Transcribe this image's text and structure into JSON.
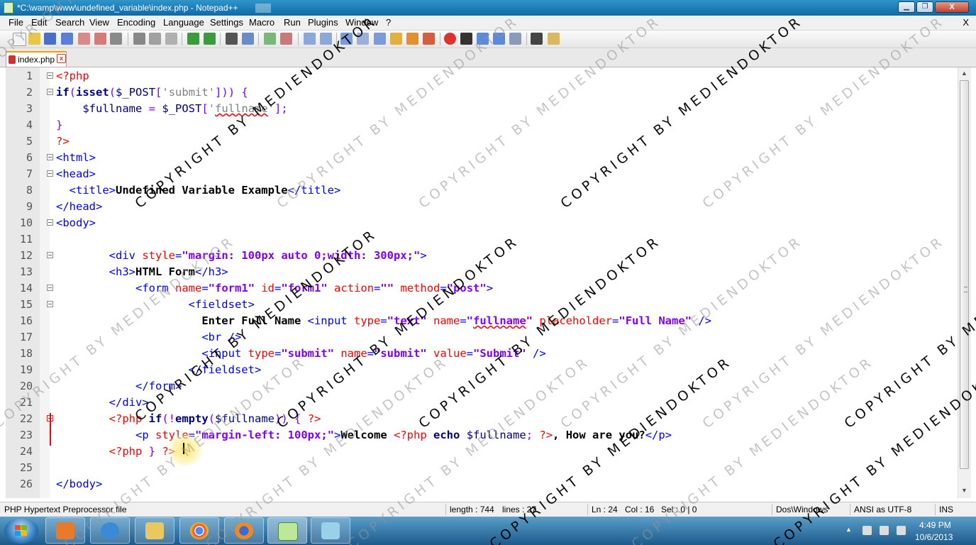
{
  "window": {
    "title": "*C:\\wamp\\www\\undefined_variable\\index.php - Notepad++",
    "minimize": "▁",
    "maximize": "❐",
    "close": "X"
  },
  "menu": [
    "File",
    "Edit",
    "Search",
    "View",
    "Encoding",
    "Language",
    "Settings",
    "Macro",
    "Run",
    "Plugins",
    "Window",
    "?"
  ],
  "menu_close": "X",
  "tab": {
    "label": "index.php",
    "close": "x"
  },
  "editor": {
    "lines": [
      {
        "n": "1",
        "html": "<span class='tk-php'>&lt;?php</span>"
      },
      {
        "n": "2",
        "html": "<span class='tk-kw'>if</span><span class='tk-op'>(</span><span class='tk-kw'>isset</span><span class='tk-op'>(</span><span class='tk-var'>$_POST</span><span class='tk-op'>[</span><span class='tk-str'>'submit'</span><span class='tk-op'>])) {</span>"
      },
      {
        "n": "3",
        "html": "    <span class='tk-var'>$fullname</span> <span class='tk-op'>=</span> <span class='tk-var'>$_POST</span><span class='tk-op'>[</span><span class='tk-str'>'<span class=\"squig\">fullname</span>'</span><span class='tk-op'>];</span>"
      },
      {
        "n": "4",
        "html": "<span class='tk-op'>}</span>"
      },
      {
        "n": "5",
        "html": "<span class='tk-php'>?&gt;</span>"
      },
      {
        "n": "6",
        "html": "<span class='tk-tag'>&lt;html&gt;</span>"
      },
      {
        "n": "7",
        "html": "<span class='tk-tag'>&lt;head&gt;</span>"
      },
      {
        "n": "8",
        "html": "  <span class='tk-tag'>&lt;title&gt;</span><span class='tk-txt'>Undefined Variable Example</span><span class='tk-tag'>&lt;/title&gt;</span>"
      },
      {
        "n": "9",
        "html": "<span class='tk-tag'>&lt;/head&gt;</span>"
      },
      {
        "n": "10",
        "html": "<span class='tk-tag'>&lt;body&gt;</span>"
      },
      {
        "n": "11",
        "html": ""
      },
      {
        "n": "12",
        "html": "        <span class='tk-tag'>&lt;div</span> <span class='tk-attr'>style</span><span class='tk-tag'>=</span><span class='tk-val'>\"margin: 100px auto 0;width: 300px;\"</span><span class='tk-tag'>&gt;</span>"
      },
      {
        "n": "13",
        "html": "        <span class='tk-tag'>&lt;h3&gt;</span><span class='tk-txt'>HTML Form</span><span class='tk-tag'>&lt;/h3&gt;</span>"
      },
      {
        "n": "14",
        "html": "            <span class='tk-tag'>&lt;form</span> <span class='tk-attr'>name</span><span class='tk-tag'>=</span><span class='tk-val'>\"form1\"</span> <span class='tk-attr'>id</span><span class='tk-tag'>=</span><span class='tk-val'>\"form1\"</span> <span class='tk-attr'>action</span><span class='tk-tag'>=</span><span class='tk-val'>\"\"</span> <span class='tk-attr'>method</span><span class='tk-tag'>=</span><span class='tk-val'>\"post\"</span><span class='tk-tag'>&gt;</span>"
      },
      {
        "n": "15",
        "html": "                    <span class='tk-tag'>&lt;fieldset&gt;</span>"
      },
      {
        "n": "16",
        "html": "                      <span class='tk-txt'>Enter Full Name</span> <span class='tk-tag'>&lt;input</span> <span class='tk-attr'>type</span><span class='tk-tag'>=</span><span class='tk-val'>\"text\"</span> <span class='tk-attr'>name</span><span class='tk-tag'>=</span><span class='tk-val'>\"<span class=\"squig\">fullname</span>\"</span> <span class='tk-attr'>placeholder</span><span class='tk-tag'>=</span><span class='tk-val'>\"Full Name\"</span> <span class='tk-tag'>/&gt;</span>"
      },
      {
        "n": "17",
        "html": "                      <span class='tk-tag'>&lt;br /&gt;</span>"
      },
      {
        "n": "18",
        "html": "                      <span class='tk-tag'>&lt;input</span> <span class='tk-attr'>type</span><span class='tk-tag'>=</span><span class='tk-val'>\"submit\"</span> <span class='tk-attr'>name</span><span class='tk-tag'>=</span><span class='tk-val'>\"submit\"</span> <span class='tk-attr'>value</span><span class='tk-tag'>=</span><span class='tk-val'>\"Submit\"</span> <span class='tk-tag'>/&gt;</span>"
      },
      {
        "n": "19",
        "html": "                    <span class='tk-tag'>&lt;/fieldset&gt;</span>"
      },
      {
        "n": "20",
        "html": "            <span class='tk-tag'>&lt;/form&gt;</span>"
      },
      {
        "n": "21",
        "html": "        <span class='tk-tag'>&lt;/div&gt;</span>"
      },
      {
        "n": "22",
        "html": "        <span class='tk-php'>&lt;?php</span> <span class='tk-kw'>if</span><span class='tk-op'>(!</span><span class='tk-kw'>empty</span><span class='tk-op'>(</span><span class='tk-var'>$fullname</span><span class='tk-op'>)) {</span> <span class='tk-php'>?&gt;</span>"
      },
      {
        "n": "23",
        "html": "            <span class='tk-tag'>&lt;p</span> <span class='tk-attr'>style</span><span class='tk-tag'>=</span><span class='tk-val'>\"margin-left: 100px;\"</span><span class='tk-tag'>&gt;</span><span class='tk-txt'>Welcome</span> <span class='tk-php'>&lt;?php</span> <span class='tk-kw'>echo</span> <span class='tk-var'>$fullname</span><span class='tk-op'>;</span> <span class='tk-php'>?&gt;</span><span class='tk-txt'>, How are you?</span><span class='tk-tag'>&lt;/p&gt;</span>"
      },
      {
        "n": "24",
        "html": "        <span class='tk-php'>&lt;?php</span> <span class='tk-op'>}</span> <span class='tk-php'>?&gt;</span>"
      },
      {
        "n": "25",
        "html": ""
      },
      {
        "n": "26",
        "html": "<span class='tk-tag'>&lt;/body&gt;</span>"
      }
    ]
  },
  "status": {
    "file_type": "PHP Hypertext Preprocessor file",
    "length": "length : 744",
    "lines": "lines : 27",
    "ln": "Ln : 24",
    "col": "Col : 16",
    "sel": "Sel : 0 | 0",
    "eol": "Dos\\Windows",
    "encoding": "ANSI as UTF-8",
    "mode": "INS"
  },
  "clock": {
    "time": "4:49 PM",
    "date": "10/6/2013"
  },
  "watermark": "COPYRIGHT BY MEDIENDOKTOR",
  "colors": {
    "titlebar": "#1a78b5",
    "taskbar": "#2a6fa3",
    "php_tag": "#ff0000",
    "keyword": "#000080",
    "html_tag": "#0000ff",
    "attr_value": "#8000ff"
  }
}
